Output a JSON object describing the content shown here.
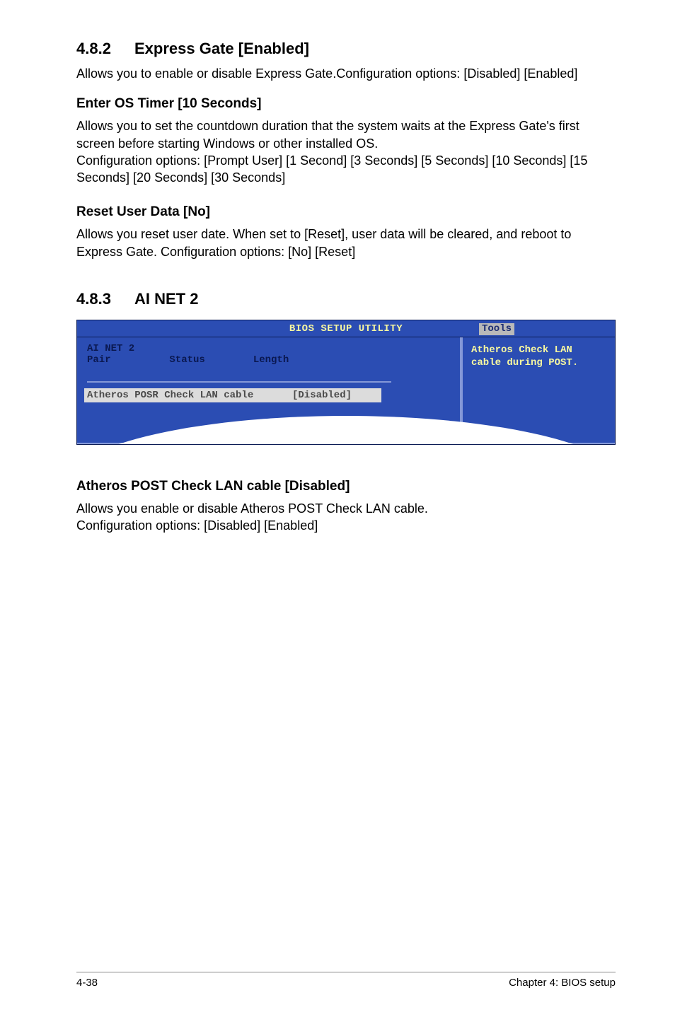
{
  "section1": {
    "number": "4.8.2",
    "title": "Express Gate [Enabled]",
    "intro": "Allows you to enable or disable Express Gate.Configuration options: [Disabled] [Enabled]",
    "sub1_heading": "Enter OS Timer [10 Seconds]",
    "sub1_body": "Allows you to set the countdown duration that the system waits at the Express Gate's first screen before starting Windows or other installed OS.\nConfiguration options: [Prompt User] [1 Second] [3 Seconds] [5 Seconds] [10 Seconds] [15 Seconds] [20 Seconds] [30 Seconds]",
    "sub2_heading": "Reset User Data [No]",
    "sub2_body": "Allows you reset user date. When set to [Reset], user data will be cleared, and reboot to Express Gate. Configuration options: [No] [Reset]"
  },
  "section2": {
    "number": "4.8.3",
    "title": "AI NET 2",
    "bios": {
      "title": "BIOS SETUP UTILITY",
      "tab": "Tools",
      "col1_line1": "AI NET 2",
      "col1_line2": "Pair",
      "col2": "Status",
      "col3": "Length",
      "row_label": "Atheros POSR Check LAN cable",
      "row_value": "[Disabled]",
      "help1": "Atheros Check LAN",
      "help2": "cable during POST."
    },
    "sub_heading": "Atheros POST Check LAN cable [Disabled]",
    "sub_body": "Allows you enable or disable Atheros POST Check LAN cable.\nConfiguration options: [Disabled] [Enabled]"
  },
  "footer": {
    "left": "4-38",
    "right": "Chapter 4: BIOS setup"
  }
}
